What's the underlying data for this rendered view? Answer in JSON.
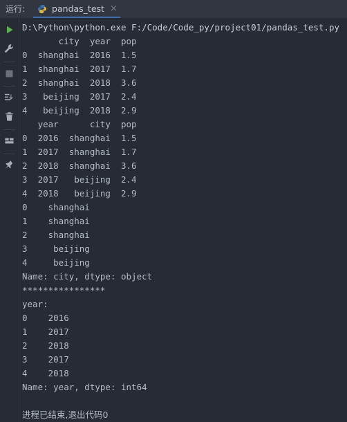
{
  "header": {
    "run_label": "运行:",
    "tab": {
      "icon": "python-icon",
      "title": "pandas_test",
      "close_glyph": "×",
      "underline_color": "#3c6eb4"
    }
  },
  "toolbar": {
    "items": [
      {
        "name": "rerun-button",
        "icon": "play-icon",
        "color": "#5aaf52"
      },
      {
        "name": "settings-button",
        "icon": "wrench-icon",
        "color": "#a9adb5"
      },
      {
        "name": "stop-button",
        "icon": "stop-square-icon",
        "color": "#6b7079"
      },
      {
        "name": "soft-wrap-button",
        "icon": "wrap-lines-icon",
        "color": "#a9adb5"
      },
      {
        "name": "clear-all-button",
        "icon": "trash-icon",
        "color": "#a9adb5"
      },
      {
        "name": "layout-button",
        "icon": "layout-icon",
        "color": "#a9adb5"
      },
      {
        "name": "pin-tab-button",
        "icon": "pin-icon",
        "color": "#a9adb5"
      }
    ]
  },
  "console": {
    "lines": [
      {
        "text": "D:\\Python\\python.exe F:/Code/Code_py/project01/pandas_test.py",
        "kind": "cmd"
      },
      {
        "text": "       city  year  pop",
        "kind": "out"
      },
      {
        "text": "0  shanghai  2016  1.5",
        "kind": "out"
      },
      {
        "text": "1  shanghai  2017  1.7",
        "kind": "out"
      },
      {
        "text": "2  shanghai  2018  3.6",
        "kind": "out"
      },
      {
        "text": "3   beijing  2017  2.4",
        "kind": "out"
      },
      {
        "text": "4   beijing  2018  2.9",
        "kind": "out"
      },
      {
        "text": "   year      city  pop",
        "kind": "out"
      },
      {
        "text": "0  2016  shanghai  1.5",
        "kind": "out"
      },
      {
        "text": "1  2017  shanghai  1.7",
        "kind": "out"
      },
      {
        "text": "2  2018  shanghai  3.6",
        "kind": "out"
      },
      {
        "text": "3  2017   beijing  2.4",
        "kind": "out"
      },
      {
        "text": "4  2018   beijing  2.9",
        "kind": "out"
      },
      {
        "text": "0    shanghai",
        "kind": "out"
      },
      {
        "text": "1    shanghai",
        "kind": "out"
      },
      {
        "text": "2    shanghai",
        "kind": "out"
      },
      {
        "text": "3     beijing",
        "kind": "out"
      },
      {
        "text": "4     beijing",
        "kind": "out"
      },
      {
        "text": "Name: city, dtype: object",
        "kind": "out"
      },
      {
        "text": "****************",
        "kind": "stars"
      },
      {
        "text": "year:",
        "kind": "out"
      },
      {
        "text": "0    2016",
        "kind": "out"
      },
      {
        "text": "1    2017",
        "kind": "out"
      },
      {
        "text": "2    2018",
        "kind": "out"
      },
      {
        "text": "3    2017",
        "kind": "out"
      },
      {
        "text": "4    2018",
        "kind": "out"
      },
      {
        "text": "Name: year, dtype: int64",
        "kind": "out"
      },
      {
        "text": " ",
        "kind": "blank"
      },
      {
        "text": "进程已结束,退出代码0",
        "kind": "exit"
      }
    ]
  },
  "colors": {
    "header_bg": "#313640",
    "console_bg": "#272b33",
    "text": "#b5bcc6",
    "accent_blue": "#3c6eb4",
    "run_green": "#5aaf52"
  }
}
